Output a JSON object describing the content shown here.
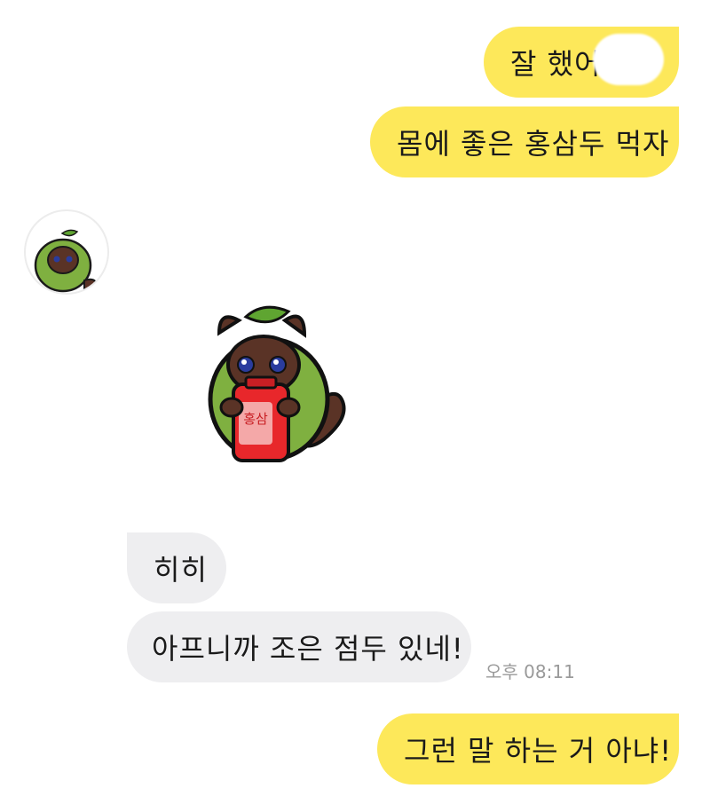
{
  "messages": {
    "m1": "잘 했어",
    "m2": "몸에 좋은 홍삼두 먹자",
    "m3": "히히",
    "m4": "아프니까 조은 점두 있네!",
    "m5": "그런 말 하는 거 아냐!"
  },
  "timestamp": "오후 08:11",
  "sticker": {
    "bottle_text": "홍삼",
    "icon": "raccoon-holding-red-ginseng-sticker"
  },
  "avatar": {
    "icon": "raccoon-leaf-avatar-icon"
  },
  "colors": {
    "my_bubble": "#fde85a",
    "their_bubble": "#eeeef0",
    "timestamp": "#9a9a9a"
  }
}
